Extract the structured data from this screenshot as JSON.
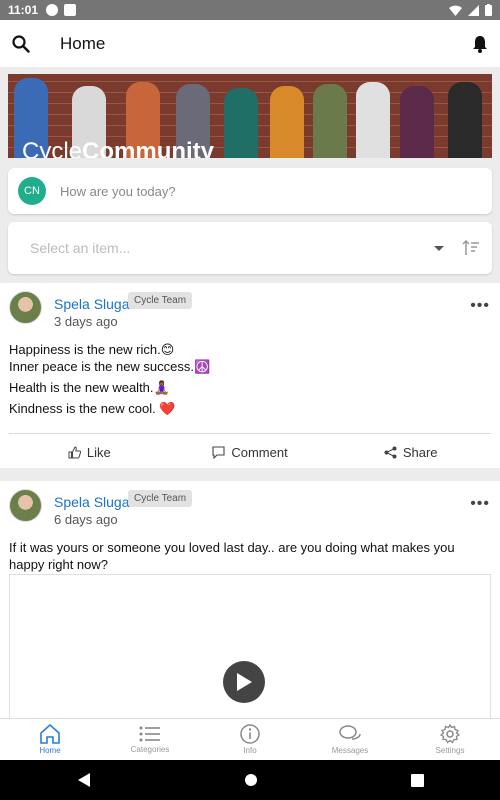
{
  "status_bar": {
    "time": "11:01"
  },
  "app_bar": {
    "title": "Home"
  },
  "banner": {
    "text_light": "Cycle",
    "text_bold": "Community"
  },
  "compose": {
    "avatar_initials": "CN",
    "placeholder": "How are you today?"
  },
  "filter": {
    "placeholder": "Select an item..."
  },
  "posts": [
    {
      "author": "Spela Sluga",
      "badge": "Cycle Team",
      "time": "3 days ago",
      "lines": [
        "Happiness is the new rich.😊",
        "Inner peace is the new success.☮️",
        "Health is the new wealth.🧘🏾‍♀️",
        "Kindness is the new cool. ❤️"
      ],
      "actions": {
        "like": "Like",
        "comment": "Comment",
        "share": "Share"
      }
    },
    {
      "author": "Spela Sluga",
      "badge": "Cycle Team",
      "time": "6 days ago",
      "lines": [
        "If it was yours or someone you loved last day.. are you doing what makes you happy right now?"
      ]
    }
  ],
  "bottom_nav": [
    {
      "label": "Home",
      "icon": "home-icon",
      "active": true
    },
    {
      "label": "Categories",
      "icon": "list-icon",
      "active": false
    },
    {
      "label": "Info",
      "icon": "info-icon",
      "active": false
    },
    {
      "label": "Messages",
      "icon": "messages-icon",
      "active": false
    },
    {
      "label": "Settings",
      "icon": "gear-icon",
      "active": false
    }
  ],
  "colors": {
    "accent": "#2a7fd4",
    "author_link": "#1a73c7",
    "avatar_cn": "#1fae8b",
    "status_bar": "#757575"
  }
}
